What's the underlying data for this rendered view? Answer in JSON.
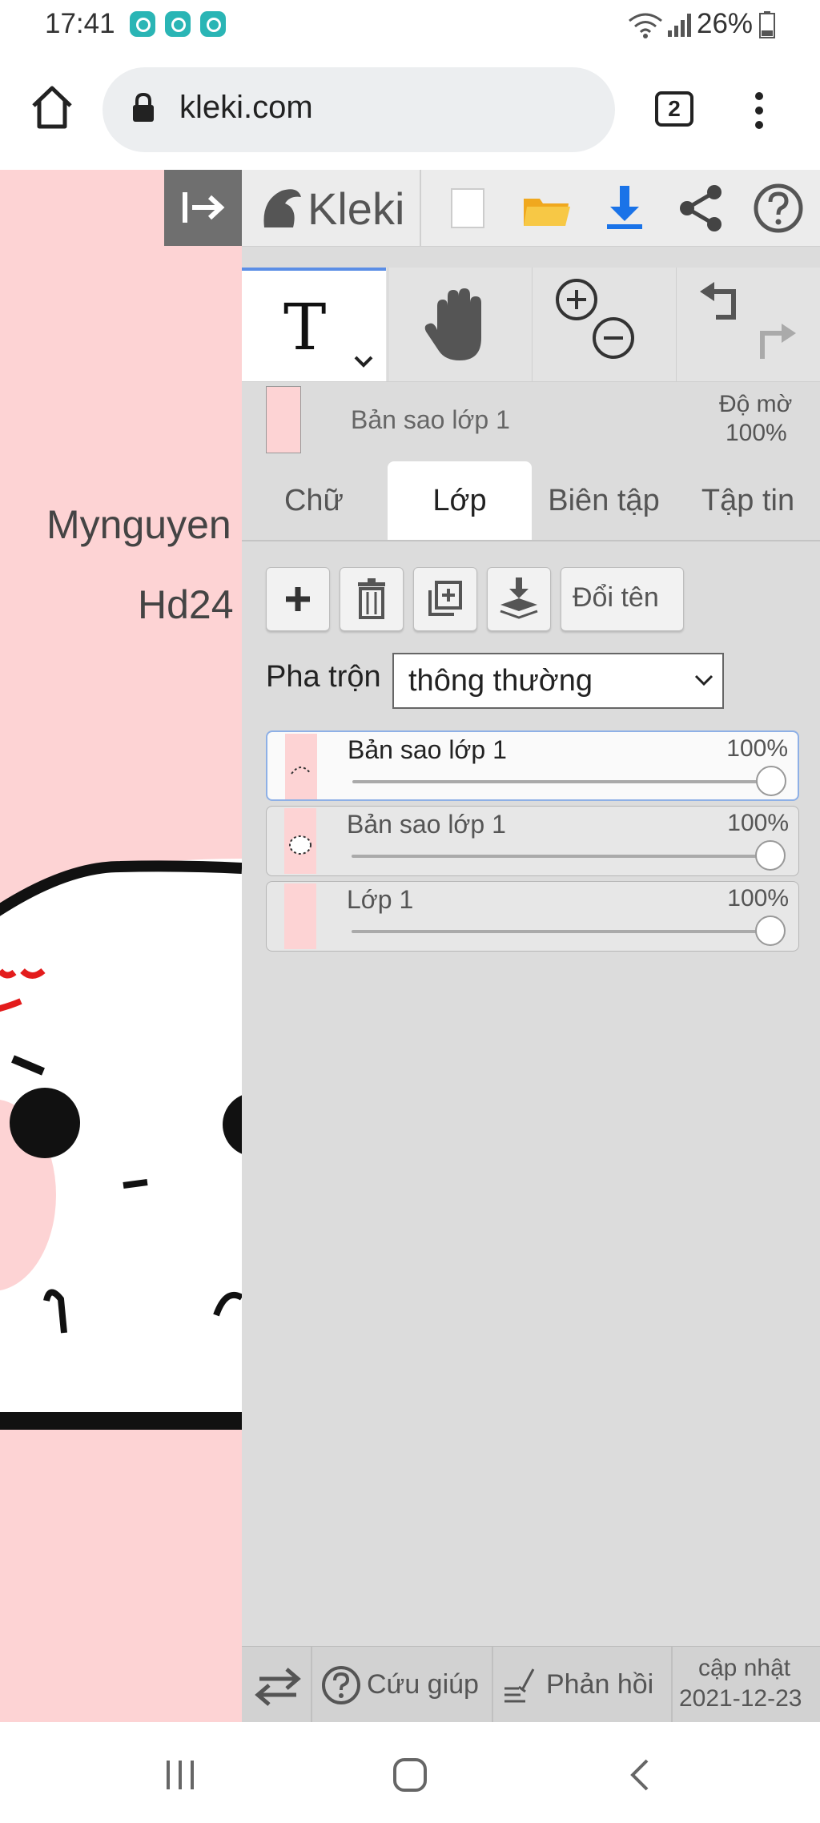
{
  "status_bar": {
    "time": "17:41",
    "battery": "26%",
    "app_icons": [
      "notification-app-icon",
      "notification-app-icon",
      "notification-app-icon"
    ]
  },
  "browser": {
    "url": "kleki.com",
    "tab_count": "2"
  },
  "canvas": {
    "text_line_1": "Mynguyen",
    "text_line_2": "Hd24"
  },
  "toolbar": {
    "brand": "Kleki",
    "icons": [
      "collapse-panel-icon",
      "kleki-logo-icon",
      "new-image-icon",
      "open-folder-icon",
      "download-icon",
      "share-icon",
      "help-icon"
    ]
  },
  "tools": {
    "text_tool_glyph": "T",
    "icons": [
      "text-tool-icon",
      "hand-tool-icon",
      "zoom-in-icon",
      "zoom-out-icon",
      "undo-icon",
      "redo-icon"
    ]
  },
  "current_layer": {
    "name": "Bản sao lớp 1",
    "opacity_label": "Độ mờ",
    "opacity_value": "100%"
  },
  "tabs": {
    "text": "Chữ",
    "layer": "Lớp",
    "edit": "Biên tập",
    "file": "Tập tin",
    "active": "layer"
  },
  "layer_actions": {
    "rename": "Đổi tên",
    "icons": [
      "add-layer-icon",
      "delete-layer-icon",
      "duplicate-layer-icon",
      "merge-down-icon"
    ]
  },
  "blend": {
    "label": "Pha trộn",
    "value": "thông thường"
  },
  "layers": [
    {
      "name": "Bản sao lớp 1",
      "opacity": "100%",
      "opacity_fraction": 1.0,
      "active": true
    },
    {
      "name": "Bản sao lớp 1",
      "opacity": "100%",
      "opacity_fraction": 1.0,
      "active": false
    },
    {
      "name": "Lớp 1",
      "opacity": "100%",
      "opacity_fraction": 1.0,
      "active": false
    }
  ],
  "footer": {
    "help": "Cứu giúp",
    "feedback": "Phản hồi",
    "update_label": "cập nhật",
    "update_date": "2021-12-23"
  },
  "colors": {
    "canvas_bg": "#fdd3d4",
    "panel_bg": "#dcdcdc",
    "accent_blue": "#1a73e8",
    "folder_yellow": "#f5b82e"
  }
}
